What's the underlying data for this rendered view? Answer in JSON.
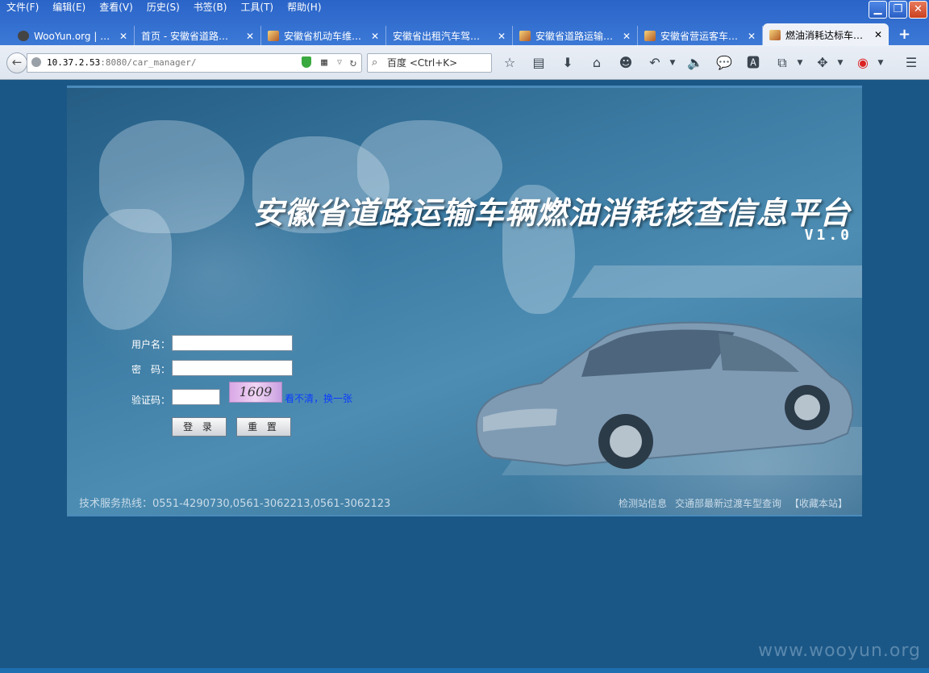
{
  "menu": [
    "文件(F)",
    "编辑(E)",
    "查看(V)",
    "历史(S)",
    "书签(B)",
    "工具(T)",
    "帮助(H)"
  ],
  "tabs": [
    {
      "title": "WooYun.org | …",
      "active": false
    },
    {
      "title": "首页 - 安徽省道路…",
      "active": false
    },
    {
      "title": "安徽省机动车维…",
      "active": false
    },
    {
      "title": "安徽省出租汽车驾…",
      "active": false
    },
    {
      "title": "安徽省道路运输…",
      "active": false
    },
    {
      "title": "安徽省营运客车…",
      "active": false
    },
    {
      "title": "燃油消耗达标车…",
      "active": true
    }
  ],
  "url": {
    "host": "10.37.2.53",
    "path": ":8080/car_manager/"
  },
  "search": {
    "placeholder": "百度 <Ctrl+K>"
  },
  "page": {
    "title": "安徽省道路运输车辆燃油消耗核查信息平台",
    "version": "V1.0",
    "form": {
      "username_label": "用户名：",
      "password_label": "密　码：",
      "captcha_label": "验证码：",
      "captcha_text": "1609",
      "refresh_link": "看不清，换一张",
      "login_button": "登 录",
      "reset_button": "重 置"
    },
    "hotline": "技术服务热线：0551-4290730,0561-3062213,0561-3062123",
    "footer_links": [
      "检测站信息",
      "交通部最新过渡车型查询",
      "【收藏本站】"
    ]
  },
  "watermark": "www.wooyun.org",
  "colors": {
    "page_bg": "#1b5786",
    "titlebar": "#2a64c8",
    "link": "#0c3cff"
  }
}
